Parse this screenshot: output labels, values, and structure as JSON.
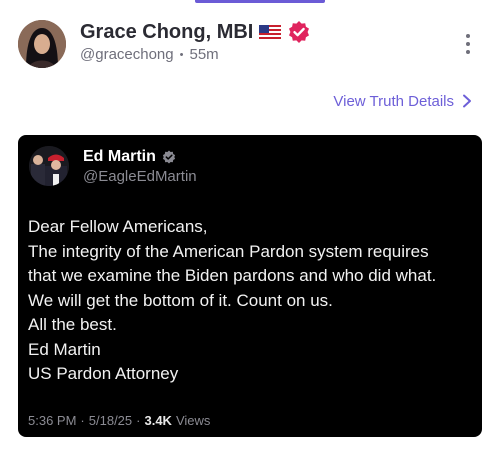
{
  "post": {
    "author_name": "Grace Chong, MBI",
    "author_flag": "US flag",
    "author_handle": "@gracechong",
    "separator": "•",
    "time_ago": "55m",
    "view_details_label": "View Truth Details"
  },
  "embedded": {
    "name": "Ed Martin",
    "handle": "@EagleEdMartin",
    "lines": [
      "Dear Fellow Americans,",
      "The integrity of the American Pardon system requires",
      "that we examine the Biden pardons and who did what.",
      "We will get the bottom of it. Count on us.",
      "All the best.",
      "Ed Martin",
      "US Pardon Attorney"
    ],
    "time": "5:36 PM",
    "meta_sep": "·",
    "date": "5/18/25",
    "views_count": "3.4K",
    "views_label": "Views"
  },
  "colors": {
    "accent": "#6d5fd8",
    "verified": "#e0245e",
    "card_bg": "#000000"
  }
}
